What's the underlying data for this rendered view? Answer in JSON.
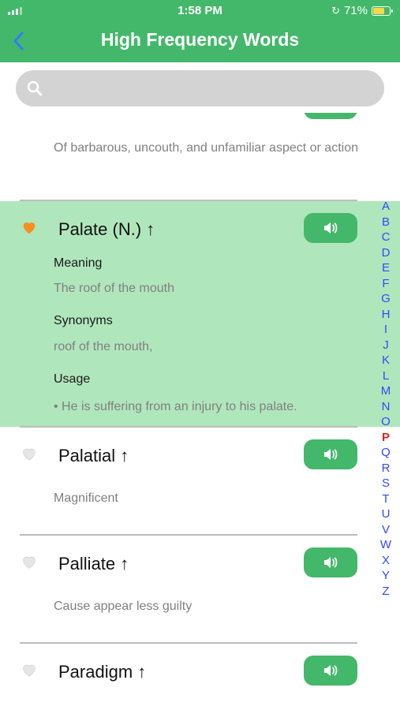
{
  "status_bar": {
    "time": "1:58 PM",
    "battery": "71%",
    "battery_level": 0.71
  },
  "header": {
    "title": "High Frequency Words"
  },
  "search": {
    "placeholder": ""
  },
  "partial_entry": {
    "definition": "Of barbarous, uncouth, and unfamiliar aspect or action"
  },
  "expanded_entry": {
    "word": "Palate (N.) ↑",
    "meaning_label": "Meaning",
    "meaning": "The roof of the mouth",
    "synonyms_label": "Synonyms",
    "synonyms": "roof of the mouth,",
    "usage_label": "Usage",
    "usage": "• He is suffering from an injury to his palate."
  },
  "entries": [
    {
      "word": "Palatial ↑",
      "definition": "Magnificent"
    },
    {
      "word": "Palliate ↑",
      "definition": "Cause appear less guilty"
    },
    {
      "word": "Paradigm ↑",
      "definition": ""
    }
  ],
  "alphabet": [
    "A",
    "B",
    "C",
    "D",
    "E",
    "F",
    "G",
    "H",
    "I",
    "J",
    "K",
    "L",
    "M",
    "N",
    "O",
    "P",
    "Q",
    "R",
    "S",
    "T",
    "U",
    "V",
    "W",
    "X",
    "Y",
    "Z"
  ],
  "active_letter": "P",
  "colors": {
    "primary": "#43b86a",
    "highlight": "#b0e6bc",
    "index_letter": "#2f4bff",
    "index_active": "#e0201f",
    "heart_active": "#f5901e",
    "heart_inactive": "#e6e6e6"
  },
  "icons": {
    "back": "chevron-left-icon",
    "search": "search-icon",
    "speaker": "speaker-icon",
    "favorite": "heart-icon"
  }
}
